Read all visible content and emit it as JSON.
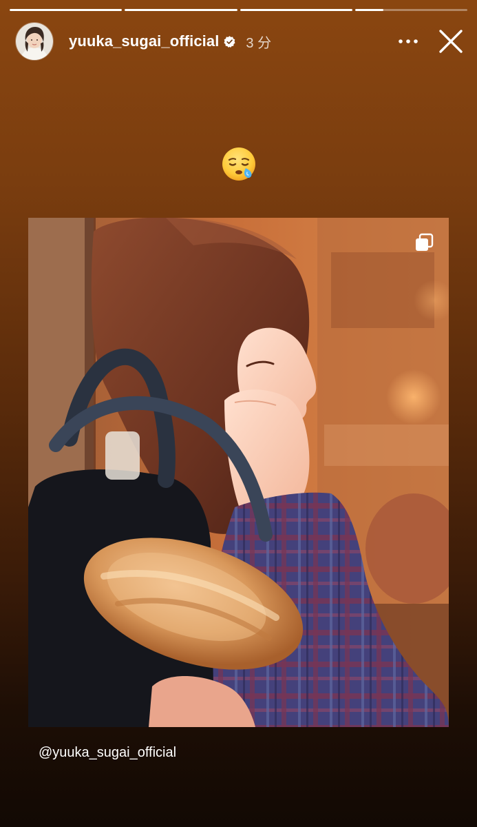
{
  "story": {
    "progress": [
      {
        "fill": 1.0
      },
      {
        "fill": 1.0
      },
      {
        "fill": 1.0
      },
      {
        "fill": 0.25
      }
    ]
  },
  "header": {
    "avatar_icon": "profile-avatar",
    "username": "yuuka_sugai_official",
    "verified_icon": "verified-badge-icon",
    "time_ago": "3 分",
    "more_icon": "more-options-icon",
    "close_icon": "close-icon"
  },
  "sticker": {
    "emoji": "😪",
    "emoji_name": "sleepy-face-emoji"
  },
  "shared_post": {
    "photo_description_icon": "shared-post-photo",
    "carousel_icon": "multiple-photos-icon",
    "mention": "@yuuka_sugai_official"
  },
  "colors": {
    "gradient_top": "#8a4610",
    "gradient_bottom": "#120904",
    "text": "#ffffff"
  }
}
